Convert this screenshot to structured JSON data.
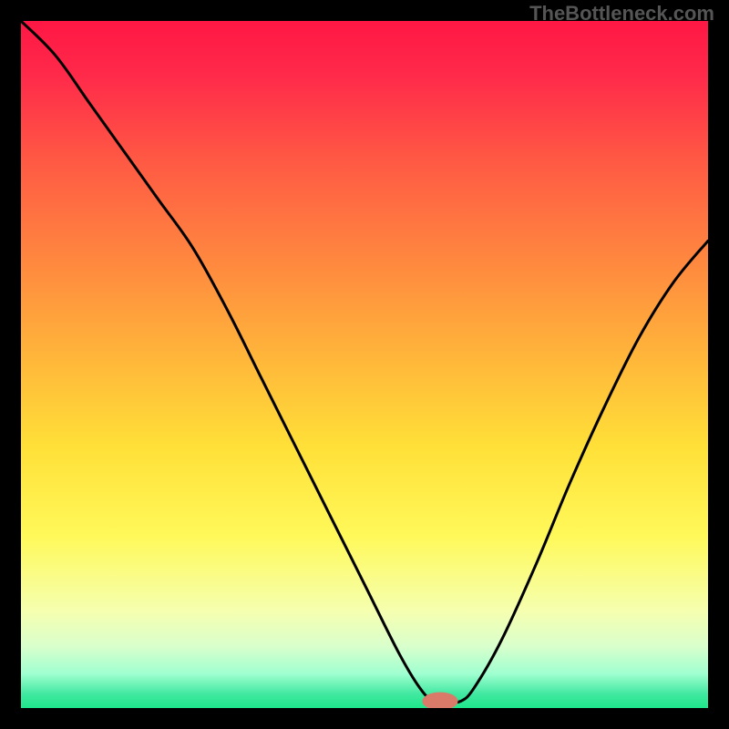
{
  "watermark": "TheBottleneck.com",
  "chart_data": {
    "type": "line",
    "title": "",
    "xlabel": "",
    "ylabel": "",
    "xlim": [
      0,
      100
    ],
    "ylim": [
      0,
      100
    ],
    "grid": false,
    "legend": false,
    "background": "heatmap-gradient",
    "gradient_stops": [
      {
        "pos": 0.0,
        "color": "#ff1744"
      },
      {
        "pos": 0.08,
        "color": "#ff2a4a"
      },
      {
        "pos": 0.2,
        "color": "#ff5844"
      },
      {
        "pos": 0.35,
        "color": "#ff883f"
      },
      {
        "pos": 0.5,
        "color": "#ffb93a"
      },
      {
        "pos": 0.62,
        "color": "#ffe038"
      },
      {
        "pos": 0.75,
        "color": "#fff95a"
      },
      {
        "pos": 0.86,
        "color": "#f5ffb0"
      },
      {
        "pos": 0.91,
        "color": "#d9ffcc"
      },
      {
        "pos": 0.95,
        "color": "#a0ffd0"
      },
      {
        "pos": 0.98,
        "color": "#40e8a0"
      },
      {
        "pos": 1.0,
        "color": "#1ee68a"
      }
    ],
    "marker": {
      "x": 61,
      "y": 1,
      "color": "#d97b68",
      "rx": 2.6,
      "ry": 1.3
    },
    "series": [
      {
        "name": "bottleneck-curve",
        "color": "#000000",
        "x": [
          0,
          5,
          10,
          15,
          20,
          25,
          30,
          35,
          40,
          45,
          50,
          55,
          58,
          60,
          62,
          64,
          66,
          70,
          75,
          80,
          85,
          90,
          95,
          100
        ],
        "y": [
          100,
          95,
          88,
          81,
          74,
          67,
          58,
          48,
          38,
          28,
          18,
          8,
          3,
          1,
          1,
          1,
          3,
          10,
          21,
          33,
          44,
          54,
          62,
          68
        ]
      }
    ]
  }
}
